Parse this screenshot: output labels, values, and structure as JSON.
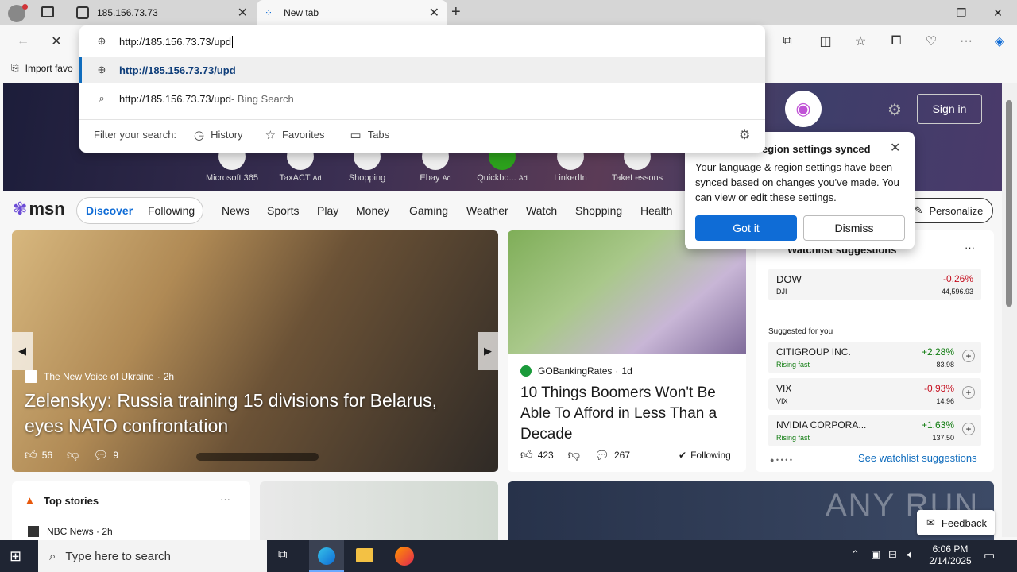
{
  "tabs": [
    {
      "title": "185.156.73.73"
    },
    {
      "title": "New tab"
    }
  ],
  "address": {
    "value": "http://185.156.73.73/upd"
  },
  "suggestions": [
    {
      "text": "http://185.156.73.73/upd"
    },
    {
      "text": "http://185.156.73.73/upd",
      "suffix": " - Bing Search"
    }
  ],
  "filter": {
    "label": "Filter your search:",
    "items": [
      "History",
      "Favorites",
      "Tabs"
    ]
  },
  "favbar": {
    "import": "Import favo"
  },
  "quicklinks": [
    {
      "label": "Microsoft 365",
      "ad": ""
    },
    {
      "label": "TaxACT",
      "ad": "Ad"
    },
    {
      "label": "Shopping",
      "ad": ""
    },
    {
      "label": "Ebay",
      "ad": "Ad"
    },
    {
      "label": "Quickbo...",
      "ad": "Ad"
    },
    {
      "label": "LinkedIn",
      "ad": ""
    },
    {
      "label": "TakeLessons",
      "ad": ""
    }
  ],
  "header": {
    "signin": "Sign in"
  },
  "nav": {
    "brand": "msn",
    "items": [
      "Discover",
      "Following",
      "News",
      "Sports",
      "Play",
      "Money",
      "Gaming",
      "Weather",
      "Watch",
      "Shopping",
      "Health"
    ],
    "personalize": "Personalize"
  },
  "popup": {
    "title": "region settings synced",
    "body": "Your language & region settings have been synced based on changes you've made. You can view or edit these settings.",
    "gotit": "Got it",
    "dismiss": "Dismiss"
  },
  "hero": {
    "source": "The New Voice of Ukraine",
    "age": "2h",
    "headline": "Zelenskyy: Russia training 15 divisions for Belarus, eyes NATO confrontation",
    "likes": "56",
    "comments": "9"
  },
  "card2": {
    "source": "GOBankingRates",
    "age": "1d",
    "headline": "10 Things Boomers Won't Be Able To Afford in Less Than a Decade",
    "likes": "423",
    "comments": "267",
    "following": "Following"
  },
  "watch": {
    "title": "Watchlist suggestions",
    "suggested": "Suggested for you",
    "link": "See watchlist suggestions",
    "rows": [
      {
        "name": "DOW",
        "sub": "DJI",
        "change": "-0.26%",
        "price": "44,596.93",
        "dir": "down"
      },
      {
        "name": "CITIGROUP INC.",
        "sub": "Rising fast",
        "change": "+2.28%",
        "price": "83.98",
        "dir": "up"
      },
      {
        "name": "VIX",
        "sub": "VIX",
        "change": "-0.93%",
        "price": "14.96",
        "dir": "down"
      },
      {
        "name": "NVIDIA CORPORA...",
        "sub": "Rising fast",
        "change": "+1.63%",
        "price": "137.50",
        "dir": "up"
      }
    ]
  },
  "topstories": {
    "title": "Top stories",
    "source": "NBC News",
    "age": "2h"
  },
  "feedback": "Feedback",
  "watermark": "ANY RUN",
  "taskbar": {
    "search": "Type here to search",
    "time": "6:06 PM",
    "date": "2/14/2025"
  },
  "colors": {
    "accent": "#0f6cd6",
    "up": "#107c10",
    "down": "#c50f1f"
  }
}
